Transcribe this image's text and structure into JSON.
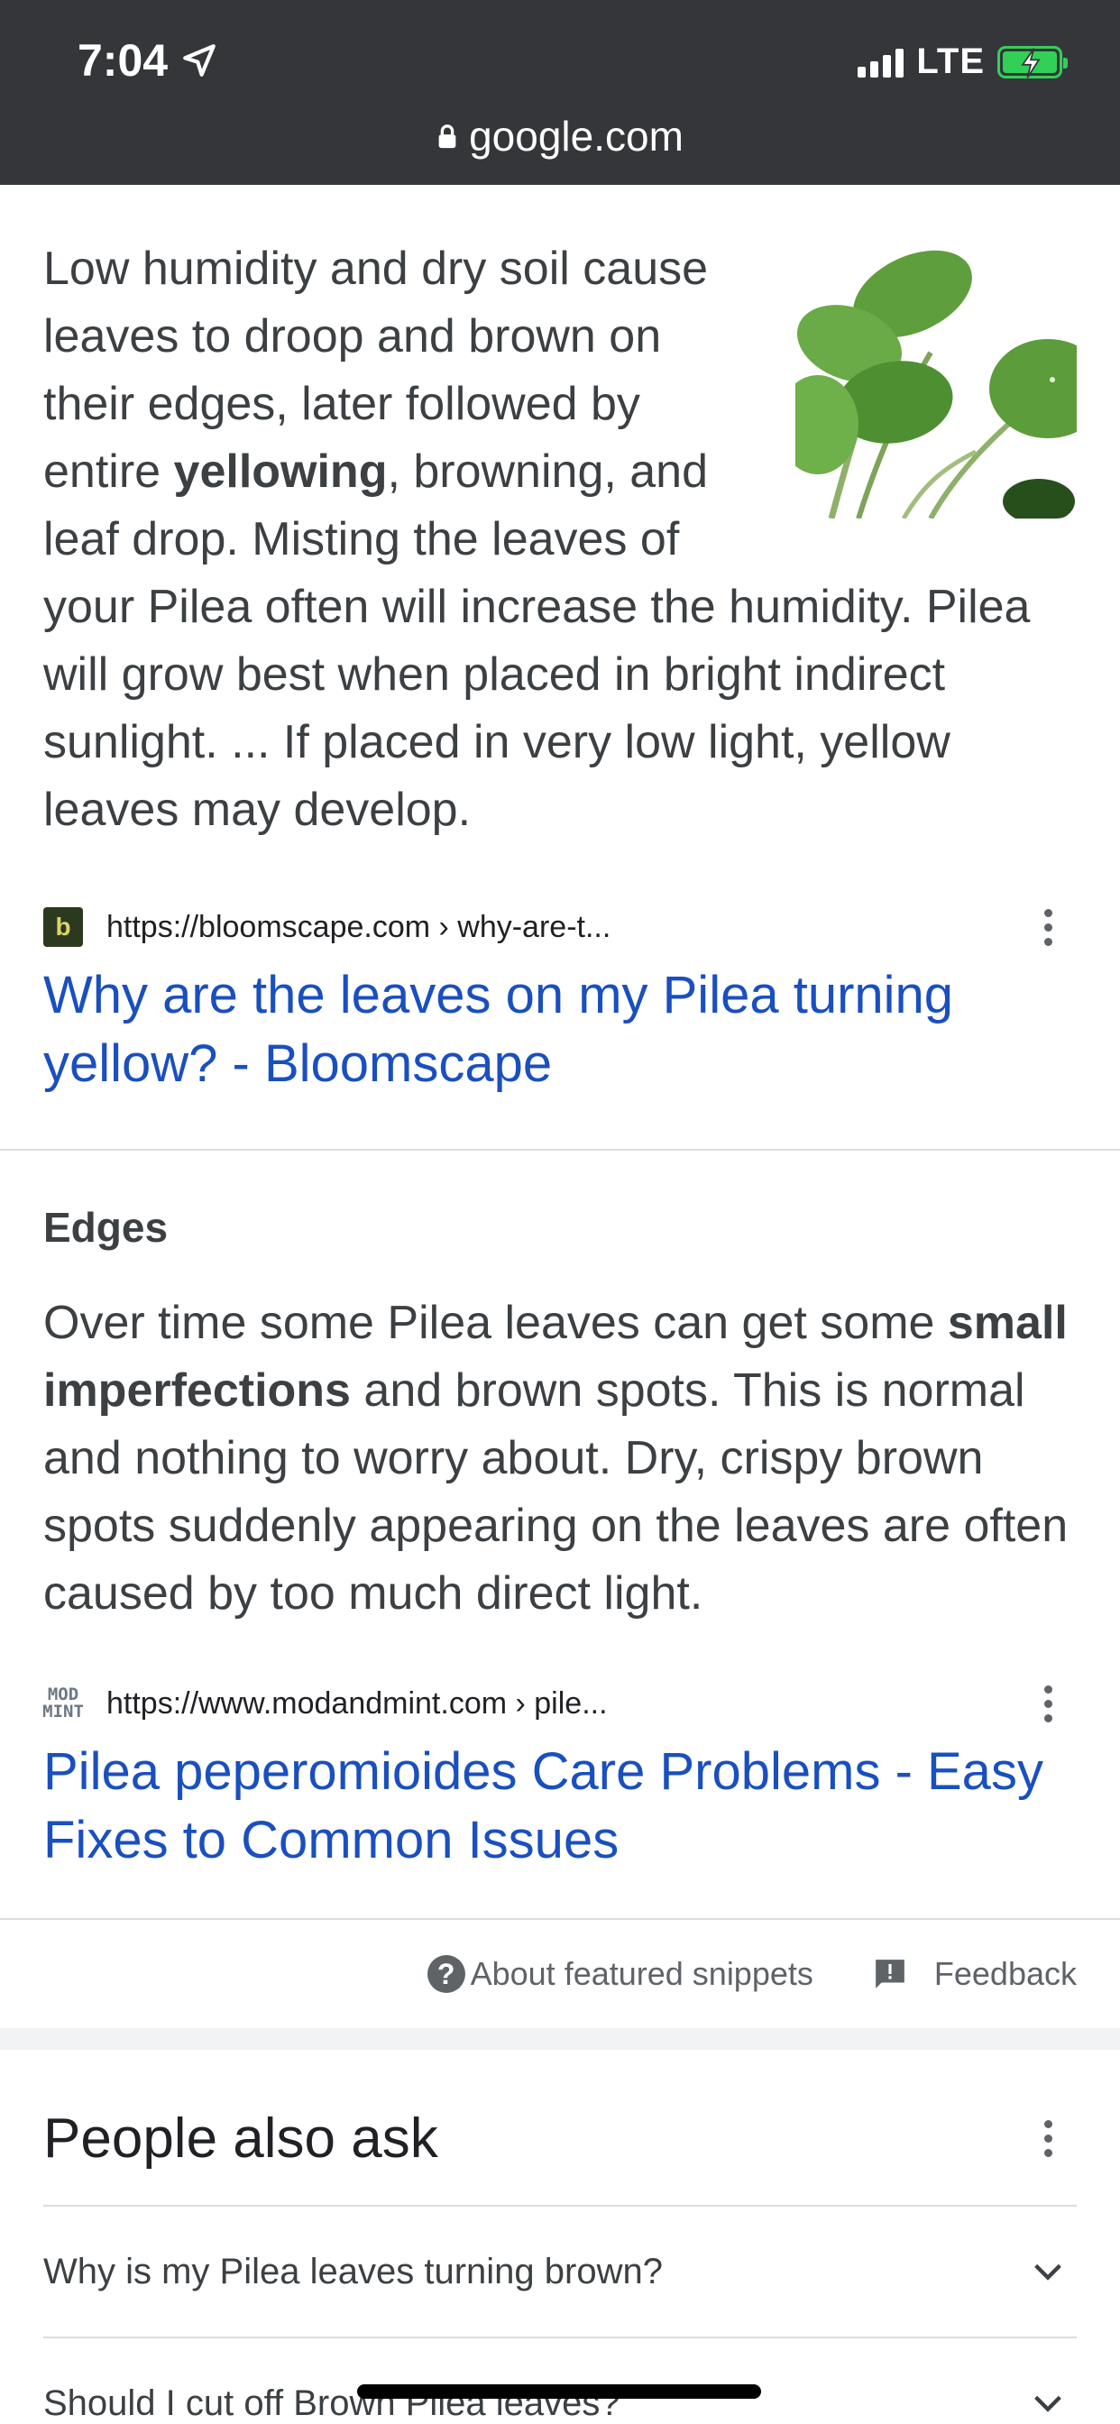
{
  "status_bar": {
    "time": "7:04",
    "network": "LTE"
  },
  "url_bar": {
    "domain": "google.com"
  },
  "snippet1": {
    "text_before": "Low humidity and dry soil cause leaves to droop and brown on their edges, later followed by entire ",
    "bold": "yellowing",
    "text_after": ", browning, and leaf drop. Misting the leaves of your Pilea often will increase the humidity. Pilea will grow best when placed in bright indirect sunlight. ... If placed in very low light, yellow leaves may develop.",
    "favicon_letter": "b",
    "source_url": "https://bloomscape.com › why-are-t...",
    "link_title": "Why are the leaves on my Pilea turning yellow? - Bloomscape"
  },
  "snippet2": {
    "heading": "Edges",
    "text_before": "Over time some Pilea leaves can get some ",
    "bold": "small imperfections",
    "text_after": " and brown spots. This is normal and nothing to worry about. Dry, crispy brown spots suddenly appearing on the leaves are often caused by too much direct light.",
    "favicon_line1": "MOD",
    "favicon_line2": "MINT",
    "source_url": "https://www.modandmint.com › pile...",
    "link_title": "Pilea peperomioides Care Problems - Easy Fixes to Common Issues"
  },
  "footer": {
    "about": "About featured snippets",
    "feedback": "Feedback"
  },
  "people_also_ask": {
    "title": "People also ask",
    "questions": [
      "Why is my Pilea leaves turning brown?",
      "Should I cut off Brown Pilea leaves?"
    ]
  },
  "colors": {
    "link": "#1a4fbf",
    "topbar": "#35363a",
    "battery": "#31d158"
  }
}
